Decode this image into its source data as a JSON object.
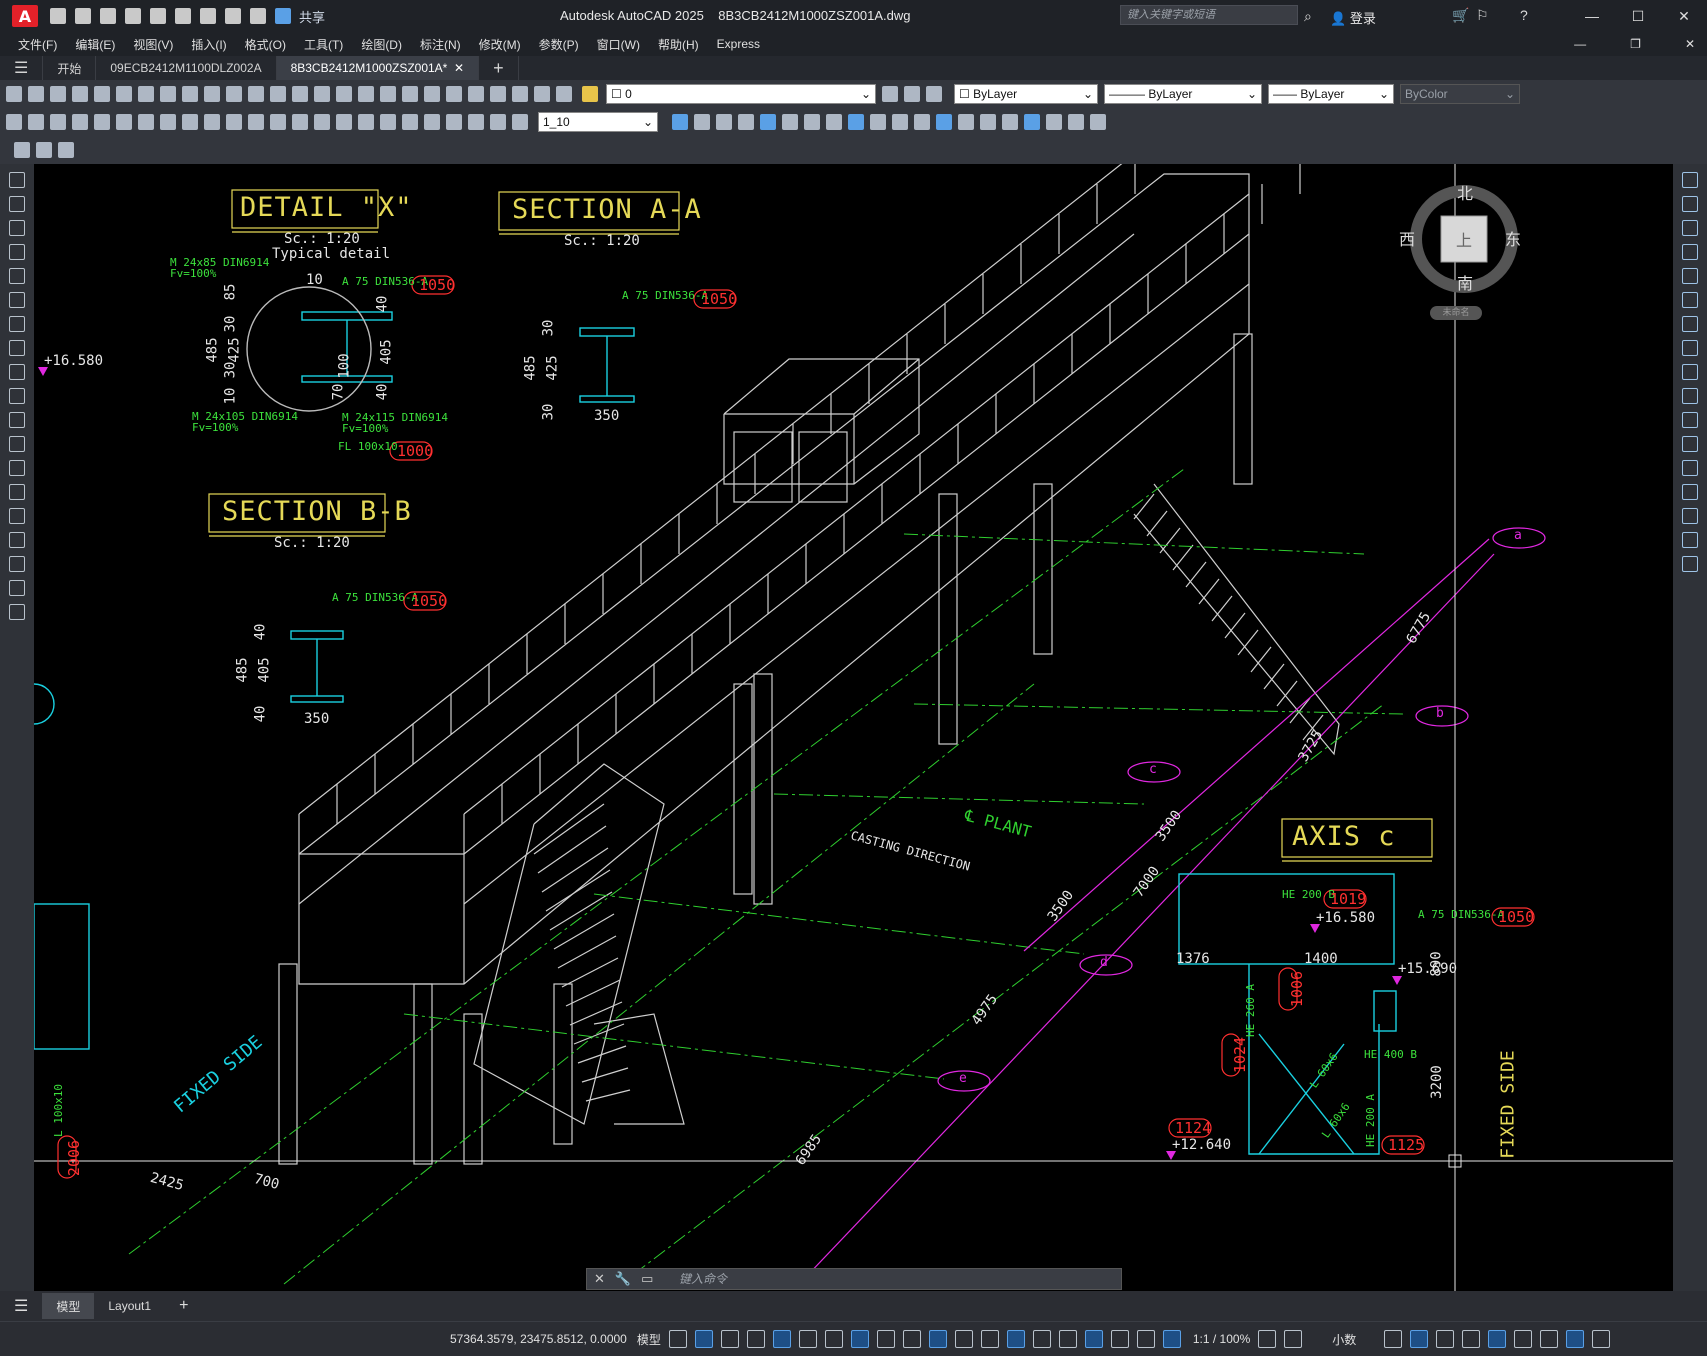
{
  "app": {
    "title": "Autodesk AutoCAD 2025",
    "file": "8B3CB2412M1000ZSZ001A.dwg",
    "logo_letter": "A",
    "share": "共享",
    "search_placeholder": "键入关键字或短语",
    "login": "登录"
  },
  "menu": [
    "文件(F)",
    "编辑(E)",
    "视图(V)",
    "插入(I)",
    "格式(O)",
    "工具(T)",
    "绘图(D)",
    "标注(N)",
    "修改(M)",
    "参数(P)",
    "窗口(W)",
    "帮助(H)",
    "Express"
  ],
  "tabs": {
    "start": "开始",
    "doc1": "09ECB2412M1100DLZ002A",
    "doc2": "8B3CB2412M1000ZSZ001A*",
    "plus": "+"
  },
  "props": {
    "layer": "0",
    "color": "ByLayer",
    "linetype": "ByLayer",
    "lineweight": "ByLayer",
    "plotstyle": "ByColor",
    "dimscale": "1_10"
  },
  "compass": {
    "n": "北",
    "s": "南",
    "e": "东",
    "w": "西",
    "top": "上",
    "wcs": "未命名"
  },
  "drawing": {
    "detail_x": {
      "title": "DETAIL \"X\"",
      "scale": "Sc.: 1:20",
      "note": "Typical detail"
    },
    "section_aa": {
      "title": "SECTION A-A",
      "scale": "Sc.: 1:20"
    },
    "section_bb": {
      "title": "SECTION B-B",
      "scale": "Sc.: 1:20"
    },
    "axis_c": {
      "title": "AXIS c"
    },
    "labels_green": [
      "M 24x85 DIN6914",
      "Fv=100%",
      "A 75 DIN536-A",
      "M 24x105 DIN6914",
      "Fv=100%",
      "M 24x115 DIN6914",
      "Fv=100%",
      "FL 100x10",
      "A 75 DIN536-A",
      "A 75 DIN536-A",
      "HE 200 B",
      "A 75 DIN536-A",
      "HE 260 A",
      "HE 400 B",
      "L 60x6",
      "L 60x6",
      "HE 200 A",
      "L 100x10"
    ],
    "bubbles": [
      "1050",
      "1000",
      "1050",
      "1050",
      "1019",
      "1050",
      "1006",
      "1024",
      "1124",
      "1125",
      "2006"
    ],
    "dims_white": [
      "10",
      "85",
      "30",
      "485",
      "425",
      "30",
      "10",
      "40",
      "405",
      "100",
      "70",
      "40",
      "30",
      "485",
      "425",
      "30",
      "350",
      "40",
      "485",
      "405",
      "40",
      "350",
      "1376",
      "1400",
      "890",
      "3200"
    ],
    "elevations": [
      "+16.580",
      "+16.580",
      "+15.690",
      "+12.640"
    ],
    "dims_rot": [
      "6775",
      "3725",
      "3500",
      "7000",
      "3500",
      "4975",
      "6985",
      "2425",
      "700"
    ],
    "grid_bubbles": [
      "a",
      "b",
      "c",
      "d",
      "e"
    ],
    "plant": "℄ PLANT",
    "casting": "CASTING DIRECTION",
    "fixed_side": "FIXED SIDE"
  },
  "command": {
    "placeholder": "键入命令"
  },
  "layouts": [
    "模型",
    "Layout1",
    "+"
  ],
  "status": {
    "coords": "57364.3579, 23475.8512, 0.0000",
    "model": "模型",
    "scale": "1:1 / 100%",
    "units": "小数"
  },
  "colors": {
    "background": "#000000",
    "dim_yellow": "#e5d957",
    "annot_green": "#3ce13c",
    "bubble_red": "#ff3030",
    "grid_magenta": "#e028e0",
    "steel_cyan": "#1ad0e0"
  }
}
